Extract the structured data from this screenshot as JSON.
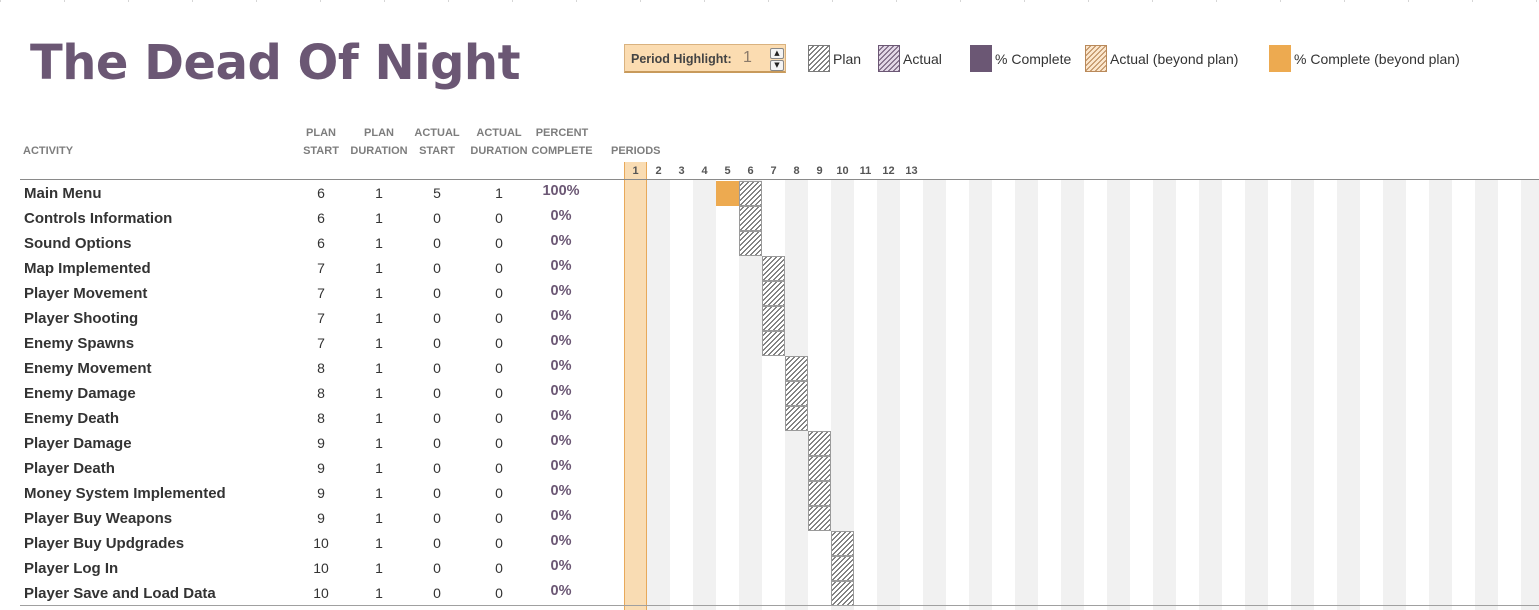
{
  "title": "The Dead Of Night",
  "period_highlight": {
    "label": "Period Highlight:",
    "value": "1"
  },
  "legend": [
    {
      "label": "Plan",
      "swatch": "plan"
    },
    {
      "label": "Actual",
      "swatch": "actual"
    },
    {
      "label": "% Complete",
      "swatch": "complete"
    },
    {
      "label": "Actual (beyond plan)",
      "swatch": "actual-beyond"
    },
    {
      "label": "% Complete (beyond plan)",
      "swatch": "complete-beyond"
    }
  ],
  "headers": {
    "activity": "ACTIVITY",
    "plan_start": [
      "PLAN",
      "START"
    ],
    "plan_duration": [
      "PLAN",
      "DURATION"
    ],
    "actual_start": [
      "ACTUAL",
      "START"
    ],
    "actual_duration": [
      "ACTUAL",
      "DURATION"
    ],
    "percent_complete": [
      "PERCENT",
      "COMPLETE"
    ],
    "periods": "PERIODS"
  },
  "period_numbers": [
    "1",
    "2",
    "3",
    "4",
    "5",
    "6",
    "7",
    "8",
    "9",
    "10",
    "11",
    "12",
    "13"
  ],
  "highlighted_period": 1,
  "colors": {
    "title": "#6b5774",
    "complete": "#6b5774",
    "beyond": "#edaa50",
    "highlight": "#f9dcb3"
  },
  "activities": [
    {
      "name": "Main Menu",
      "plan_start": "6",
      "plan_duration": "1",
      "actual_start": "5",
      "actual_duration": "1",
      "percent": "100%"
    },
    {
      "name": "Controls Information",
      "plan_start": "6",
      "plan_duration": "1",
      "actual_start": "0",
      "actual_duration": "0",
      "percent": "0%"
    },
    {
      "name": "Sound Options",
      "plan_start": "6",
      "plan_duration": "1",
      "actual_start": "0",
      "actual_duration": "0",
      "percent": "0%"
    },
    {
      "name": "Map Implemented",
      "plan_start": "7",
      "plan_duration": "1",
      "actual_start": "0",
      "actual_duration": "0",
      "percent": "0%"
    },
    {
      "name": "Player Movement",
      "plan_start": "7",
      "plan_duration": "1",
      "actual_start": "0",
      "actual_duration": "0",
      "percent": "0%"
    },
    {
      "name": "Player Shooting",
      "plan_start": "7",
      "plan_duration": "1",
      "actual_start": "0",
      "actual_duration": "0",
      "percent": "0%"
    },
    {
      "name": "Enemy Spawns",
      "plan_start": "7",
      "plan_duration": "1",
      "actual_start": "0",
      "actual_duration": "0",
      "percent": "0%"
    },
    {
      "name": "Enemy Movement",
      "plan_start": "8",
      "plan_duration": "1",
      "actual_start": "0",
      "actual_duration": "0",
      "percent": "0%"
    },
    {
      "name": "Enemy Damage",
      "plan_start": "8",
      "plan_duration": "1",
      "actual_start": "0",
      "actual_duration": "0",
      "percent": "0%"
    },
    {
      "name": "Enemy Death",
      "plan_start": "8",
      "plan_duration": "1",
      "actual_start": "0",
      "actual_duration": "0",
      "percent": "0%"
    },
    {
      "name": "Player Damage",
      "plan_start": "9",
      "plan_duration": "1",
      "actual_start": "0",
      "actual_duration": "0",
      "percent": "0%"
    },
    {
      "name": "Player Death",
      "plan_start": "9",
      "plan_duration": "1",
      "actual_start": "0",
      "actual_duration": "0",
      "percent": "0%"
    },
    {
      "name": "Money System Implemented",
      "plan_start": "9",
      "plan_duration": "1",
      "actual_start": "0",
      "actual_duration": "0",
      "percent": "0%"
    },
    {
      "name": "Player Buy Weapons",
      "plan_start": "9",
      "plan_duration": "1",
      "actual_start": "0",
      "actual_duration": "0",
      "percent": "0%"
    },
    {
      "name": "Player Buy Updgrades",
      "plan_start": "10",
      "plan_duration": "1",
      "actual_start": "0",
      "actual_duration": "0",
      "percent": "0%"
    },
    {
      "name": "Player Log In",
      "plan_start": "10",
      "plan_duration": "1",
      "actual_start": "0",
      "actual_duration": "0",
      "percent": "0%"
    },
    {
      "name": "Player Save and Load Data",
      "plan_start": "10",
      "plan_duration": "1",
      "actual_start": "0",
      "actual_duration": "0",
      "percent": "0%"
    }
  ]
}
